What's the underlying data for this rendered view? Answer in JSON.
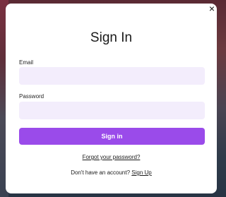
{
  "modal": {
    "title": "Sign In",
    "close_icon": "×",
    "email": {
      "label": "Email",
      "value": "",
      "placeholder": ""
    },
    "password": {
      "label": "Password",
      "value": "",
      "placeholder": ""
    },
    "submit_label": "Sign in",
    "forgot_label": "Forgot your password?",
    "signup_prompt": "Don't have an account?",
    "signup_label": "Sign Up"
  },
  "colors": {
    "accent": "#9a4bea",
    "field_bg": "#f3edfc"
  }
}
